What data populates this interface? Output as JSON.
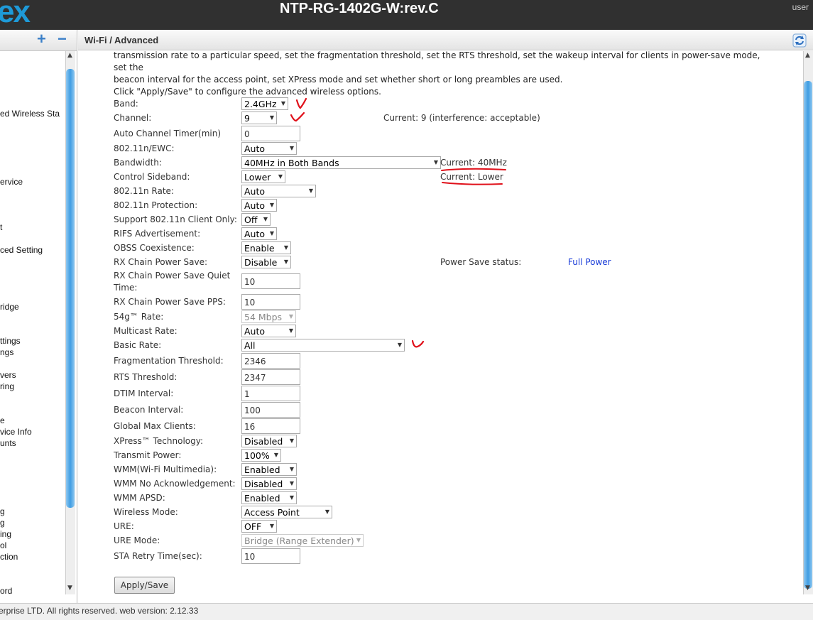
{
  "header": {
    "logo_text": "ex",
    "device_title": "NTP-RG-1402G-W:rev.C",
    "user": "user"
  },
  "sidebar": {
    "plus": "+",
    "minus": "−",
    "items": [
      "ed Wireless Sta",
      "ervice",
      "t",
      "ced Setting",
      "ridge",
      "ttings",
      "ngs",
      "vers",
      "ring",
      "e",
      "vice Info",
      "unts",
      "g",
      "g",
      "ing",
      "ol",
      "ction",
      "ord"
    ]
  },
  "page": {
    "title": "Wi-Fi / Advanced",
    "description_line1": "transmission rate to a particular speed, set the fragmentation threshold, set the RTS threshold, set the wakeup interval for clients in power-save mode, set the",
    "description_line2": "beacon interval for the access point, set XPress mode and set whether short or long preambles are used.",
    "description_line3": "Click \"Apply/Save\" to configure the advanced wireless options."
  },
  "form": {
    "band": {
      "label": "Band:",
      "value": "2.4GHz"
    },
    "channel": {
      "label": "Channel:",
      "value": "9",
      "current": "Current: 9 (interference: acceptable)"
    },
    "auto_channel_timer": {
      "label": "Auto Channel Timer(min)",
      "value": "0"
    },
    "ewc": {
      "label": "802.11n/EWC:",
      "value": "Auto"
    },
    "bandwidth": {
      "label": "Bandwidth:",
      "value": "40MHz in Both Bands",
      "current": "Current: 40MHz"
    },
    "control_sideband": {
      "label": "Control Sideband:",
      "value": "Lower",
      "current": "Current: Lower"
    },
    "n_rate": {
      "label": "802.11n Rate:",
      "value": "Auto"
    },
    "n_protection": {
      "label": "802.11n Protection:",
      "value": "Auto"
    },
    "n_client_only": {
      "label": "Support 802.11n Client Only:",
      "value": "Off"
    },
    "rifs": {
      "label": "RIFS Advertisement:",
      "value": "Auto"
    },
    "obss": {
      "label": "OBSS Coexistence:",
      "value": "Enable"
    },
    "rx_chain_power_save": {
      "label": "RX Chain Power Save:",
      "value": "Disable",
      "status_label": "Power Save status:",
      "status_value": "Full Power"
    },
    "rx_chain_quiet_time": {
      "label_line1": "RX Chain Power Save Quiet",
      "label_line2": "Time:",
      "value": "10"
    },
    "rx_chain_pps": {
      "label": "RX Chain Power Save PPS:",
      "value": "10"
    },
    "g_rate": {
      "label": "54g™ Rate:",
      "value": "54 Mbps"
    },
    "multicast_rate": {
      "label": "Multicast Rate:",
      "value": "Auto"
    },
    "basic_rate": {
      "label": "Basic Rate:",
      "value": "All"
    },
    "frag_threshold": {
      "label": "Fragmentation Threshold:",
      "value": "2346"
    },
    "rts_threshold": {
      "label": "RTS Threshold:",
      "value": "2347"
    },
    "dtim_interval": {
      "label": "DTIM Interval:",
      "value": "1"
    },
    "beacon_interval": {
      "label": "Beacon Interval:",
      "value": "100"
    },
    "global_max_clients": {
      "label": "Global Max Clients:",
      "value": "16"
    },
    "xpress": {
      "label": "XPress™ Technology:",
      "value": "Disabled"
    },
    "transmit_power": {
      "label": "Transmit Power:",
      "value": "100%"
    },
    "wmm": {
      "label": "WMM(Wi-Fi Multimedia):",
      "value": "Enabled"
    },
    "wmm_no_ack": {
      "label": "WMM No Acknowledgement:",
      "value": "Disabled"
    },
    "wmm_apsd": {
      "label": "WMM APSD:",
      "value": "Enabled"
    },
    "wireless_mode": {
      "label": "Wireless Mode:",
      "value": "Access Point"
    },
    "ure": {
      "label": "URE:",
      "value": "OFF"
    },
    "ure_mode": {
      "label": "URE Mode:",
      "value": "Bridge (Range Extender)"
    },
    "sta_retry_time": {
      "label": "STA Retry Time(sec):",
      "value": "10"
    }
  },
  "apply_button": "Apply/Save",
  "footer": {
    "copyright": "erprise LTD. All rights reserved. web version: 2.12.33"
  },
  "colors": {
    "topbar": "#303030",
    "accent": "#1e9ad8",
    "annotation": "#e0101a",
    "status_link": "#1a3cd8"
  }
}
